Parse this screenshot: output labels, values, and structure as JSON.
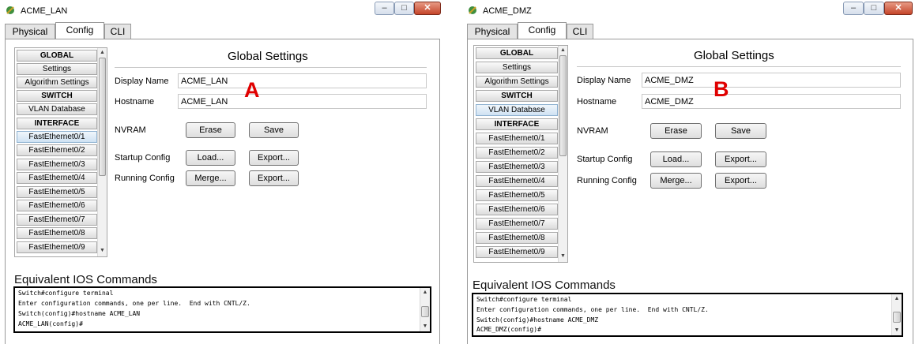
{
  "windows": [
    {
      "title": "ACME_LAN",
      "tabs": [
        "Physical",
        "Config",
        "CLI"
      ],
      "nav_items": [
        {
          "label": "GLOBAL",
          "kind": "header"
        },
        {
          "label": "Settings",
          "kind": "item"
        },
        {
          "label": "Algorithm Settings",
          "kind": "item"
        },
        {
          "label": "SWITCH",
          "kind": "header"
        },
        {
          "label": "VLAN Database",
          "kind": "item"
        },
        {
          "label": "INTERFACE",
          "kind": "header"
        },
        {
          "label": "FastEthernet0/1",
          "kind": "selected"
        },
        {
          "label": "FastEthernet0/2",
          "kind": "item"
        },
        {
          "label": "FastEthernet0/3",
          "kind": "item"
        },
        {
          "label": "FastEthernet0/4",
          "kind": "item"
        },
        {
          "label": "FastEthernet0/5",
          "kind": "item"
        },
        {
          "label": "FastEthernet0/6",
          "kind": "item"
        },
        {
          "label": "FastEthernet0/7",
          "kind": "item"
        },
        {
          "label": "FastEthernet0/8",
          "kind": "item"
        },
        {
          "label": "FastEthernet0/9",
          "kind": "item"
        }
      ],
      "global_settings": {
        "title": "Global Settings",
        "display_name_label": "Display Name",
        "display_name_value": "ACME_LAN",
        "hostname_label": "Hostname",
        "hostname_value": "ACME_LAN",
        "nvram_label": "NVRAM",
        "erase_label": "Erase",
        "save_label": "Save",
        "startup_config_label": "Startup Config",
        "load_label": "Load...",
        "export_label": "Export...",
        "running_config_label": "Running Config",
        "merge_label": "Merge..."
      },
      "marker": "A",
      "ios": {
        "title": "Equivalent IOS Commands",
        "lines": [
          "Switch#configure terminal",
          "Enter configuration commands, one per line.  End with CNTL/Z.",
          "Switch(config)#hostname ACME_LAN",
          "ACME_LAN(config)#"
        ]
      }
    },
    {
      "title": "ACME_DMZ",
      "tabs": [
        "Physical",
        "Config",
        "CLI"
      ],
      "nav_items": [
        {
          "label": "GLOBAL",
          "kind": "header"
        },
        {
          "label": "Settings",
          "kind": "item"
        },
        {
          "label": "Algorithm Settings",
          "kind": "item"
        },
        {
          "label": "SWITCH",
          "kind": "header"
        },
        {
          "label": "VLAN Database",
          "kind": "selected"
        },
        {
          "label": "INTERFACE",
          "kind": "header"
        },
        {
          "label": "FastEthernet0/1",
          "kind": "item"
        },
        {
          "label": "FastEthernet0/2",
          "kind": "item"
        },
        {
          "label": "FastEthernet0/3",
          "kind": "item"
        },
        {
          "label": "FastEthernet0/4",
          "kind": "item"
        },
        {
          "label": "FastEthernet0/5",
          "kind": "item"
        },
        {
          "label": "FastEthernet0/6",
          "kind": "item"
        },
        {
          "label": "FastEthernet0/7",
          "kind": "item"
        },
        {
          "label": "FastEthernet0/8",
          "kind": "item"
        },
        {
          "label": "FastEthernet0/9",
          "kind": "item"
        }
      ],
      "global_settings": {
        "title": "Global Settings",
        "display_name_label": "Display Name",
        "display_name_value": "ACME_DMZ",
        "hostname_label": "Hostname",
        "hostname_value": "ACME_DMZ",
        "nvram_label": "NVRAM",
        "erase_label": "Erase",
        "save_label": "Save",
        "startup_config_label": "Startup Config",
        "load_label": "Load...",
        "export_label": "Export...",
        "running_config_label": "Running Config",
        "merge_label": "Merge..."
      },
      "marker": "B",
      "ios": {
        "title": "Equivalent IOS Commands",
        "lines": [
          "Switch#configure terminal",
          "Enter configuration commands, one per line.  End with CNTL/Z.",
          "Switch(config)#hostname ACME_DMZ",
          "ACME_DMZ(config)#"
        ]
      }
    }
  ],
  "colors": {
    "marker": "#e00000",
    "close_button": "#c5452a",
    "selected_item": "#cfe2f3"
  }
}
